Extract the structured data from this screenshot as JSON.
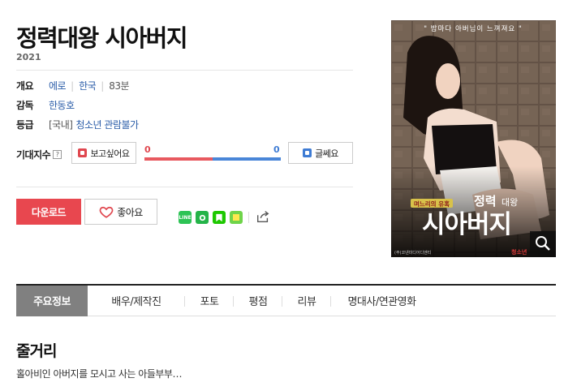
{
  "movie": {
    "title": "정력대왕 시아버지",
    "year": "2021"
  },
  "info": {
    "overview_label": "개요",
    "genre": "에로",
    "country": "한국",
    "runtime": "83분",
    "director_label": "감독",
    "director": "한동호",
    "rating_label": "등급",
    "rating_prefix": "[국내]",
    "rating": "청소년 관람불가"
  },
  "expectation": {
    "label": "기대지수",
    "help_icon": "question-icon",
    "want_label": "보고싶어요",
    "meh_label": "글쎄요",
    "want_count": "0",
    "meh_count": "0",
    "want_fraction": 0.5,
    "meh_fraction": 0.5,
    "colors": {
      "want": "#e0474f",
      "meh": "#3f7cd4"
    }
  },
  "actions": {
    "download_label": "다운로드",
    "like_label": "좋아요"
  },
  "share": {
    "icons": [
      "line-icon",
      "naver-band-icon",
      "naver-bookmark-icon",
      "kakao-icon"
    ],
    "share_icon": "share-icon"
  },
  "poster": {
    "tagline": "\" 밤마다 아버님이 느껴져요 \"",
    "badge": "며느리의 유혹",
    "title_line1_big": "정력",
    "title_line1_small": "대왕",
    "title_line2": "시아버지",
    "credits": "(주)코넨미디어디엔티",
    "corner_red": "청소년",
    "zoom_icon": "magnifier-icon"
  },
  "tabs": [
    {
      "label": "주요정보",
      "active": true
    },
    {
      "label": "배우/제작진",
      "active": false
    },
    {
      "label": "포토",
      "active": false
    },
    {
      "label": "평점",
      "active": false
    },
    {
      "label": "리뷰",
      "active": false
    },
    {
      "label": "명대사/연관영화",
      "active": false
    }
  ],
  "synopsis": {
    "title": "줄거리",
    "text": "홀아비인 아버지를 모시고 사는 아들부부…"
  }
}
